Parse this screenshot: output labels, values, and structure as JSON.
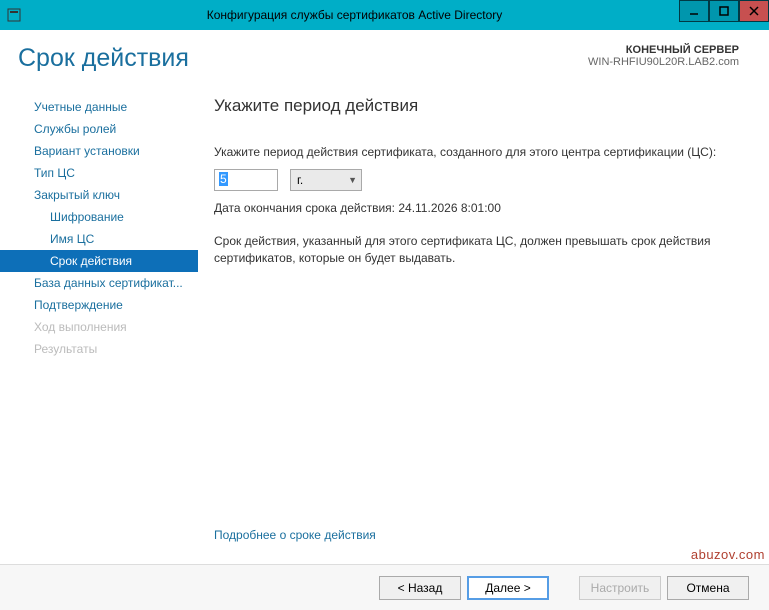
{
  "window": {
    "title": "Конфигурация службы сертификатов Active Directory"
  },
  "header": {
    "pageTitle": "Срок действия",
    "serverLabel": "КОНЕЧНЫЙ СЕРВЕР",
    "serverName": "WIN-RHFIU90L20R.LAB2.com"
  },
  "sidebar": {
    "items": [
      {
        "label": "Учетные данные",
        "child": false,
        "active": false,
        "disabled": false
      },
      {
        "label": "Службы ролей",
        "child": false,
        "active": false,
        "disabled": false
      },
      {
        "label": "Вариант установки",
        "child": false,
        "active": false,
        "disabled": false
      },
      {
        "label": "Тип ЦС",
        "child": false,
        "active": false,
        "disabled": false
      },
      {
        "label": "Закрытый ключ",
        "child": false,
        "active": false,
        "disabled": false
      },
      {
        "label": "Шифрование",
        "child": true,
        "active": false,
        "disabled": false
      },
      {
        "label": "Имя ЦС",
        "child": true,
        "active": false,
        "disabled": false
      },
      {
        "label": "Срок действия",
        "child": true,
        "active": true,
        "disabled": false
      },
      {
        "label": "База данных сертификат...",
        "child": false,
        "active": false,
        "disabled": false
      },
      {
        "label": "Подтверждение",
        "child": false,
        "active": false,
        "disabled": false
      },
      {
        "label": "Ход выполнения",
        "child": false,
        "active": false,
        "disabled": true
      },
      {
        "label": "Результаты",
        "child": false,
        "active": false,
        "disabled": true
      }
    ]
  },
  "main": {
    "heading": "Укажите период действия",
    "prompt": "Укажите период действия сертификата, созданного для этого центра сертификации (ЦС):",
    "value": "5",
    "unit": "г.",
    "expiryLabel": "Дата окончания срока действия: 24.11.2026 8:01:00",
    "description": "Срок действия, указанный для этого сертификата ЦС, должен превышать срок действия сертификатов, которые он будет выдавать.",
    "moreLink": "Подробнее о сроке действия"
  },
  "footer": {
    "back": "< Назад",
    "next": "Далее >",
    "configure": "Настроить",
    "cancel": "Отмена"
  },
  "watermark": "abuzov.com"
}
